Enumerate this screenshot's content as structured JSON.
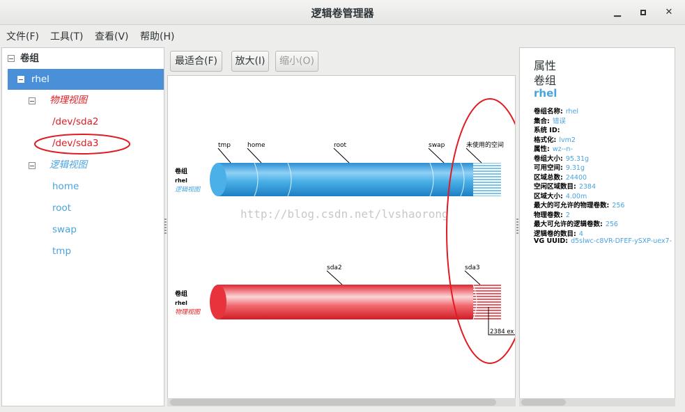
{
  "window": {
    "title": "逻辑卷管理器",
    "min": "▁",
    "max": "▫",
    "close": "✕"
  },
  "menu": [
    "文件(F)",
    "工具(T)",
    "查看(V)",
    "帮助(H)"
  ],
  "tree": {
    "root": "卷组",
    "vg": "rhel",
    "physical_view": "物理视图",
    "pv": [
      "/dev/sda2",
      "/dev/sda3"
    ],
    "logical_view": "逻辑视图",
    "lv": [
      "home",
      "root",
      "swap",
      "tmp"
    ]
  },
  "toolbar": {
    "fit": "最适合(F)",
    "zoom_in": "放大(I)",
    "zoom_out": "缩小(O)"
  },
  "canvas": {
    "logical": {
      "label1": "卷组",
      "label2": "rhel",
      "label3": "逻辑视图",
      "segments": [
        "tmp",
        "home",
        "root",
        "swap",
        "未使用的空间"
      ]
    },
    "physical": {
      "label1": "卷组",
      "label2": "rhel",
      "label3": "物理视图",
      "segments": [
        "sda2",
        "sda3"
      ],
      "extent_label": "2384 ex"
    },
    "watermark": "http://blog.csdn.net/lvshaorong"
  },
  "properties": {
    "heading1": "属性",
    "heading2": "卷组",
    "name": "rhel",
    "rows": [
      {
        "k": "卷组名称:",
        "v": "rhel"
      },
      {
        "k": "集合:",
        "v": "错误"
      },
      {
        "k": "系统 ID:",
        "v": ""
      },
      {
        "k": "格式化:",
        "v": "lvm2"
      },
      {
        "k": "属性:",
        "v": "wz--n-"
      },
      {
        "k": "卷组大小:",
        "v": "95.31g"
      },
      {
        "k": "可用空间:",
        "v": "9.31g"
      },
      {
        "k": "区域总数:",
        "v": "24400"
      },
      {
        "k": "空闲区域数目:",
        "v": "2384"
      },
      {
        "k": "区域大小:",
        "v": "4.00m"
      },
      {
        "k": "最大的可允许的物理卷数:",
        "v": "256"
      },
      {
        "k": "物理卷数:",
        "v": "2"
      },
      {
        "k": "最大可允许的逻辑卷数:",
        "v": "256"
      },
      {
        "k": "逻辑卷的数目:",
        "v": "4"
      },
      {
        "k": "VG UUID:",
        "v": "d5slwc-c8VR-DFEF-ySXP-uex7-"
      }
    ]
  },
  "colors": {
    "selection": "#4a90d9",
    "link_blue": "#4aa3df",
    "physical_red": "#e8323c",
    "annotation_red": "#e11b22"
  }
}
